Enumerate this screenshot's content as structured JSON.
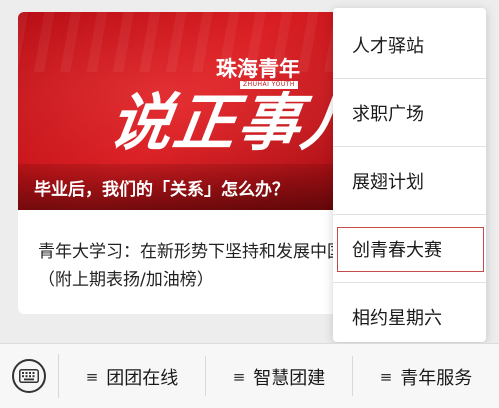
{
  "article": {
    "banner": {
      "logo_text": "珠海青年",
      "logo_subtext": "ZHUHAI YOUTH",
      "big_title": "说正事儿",
      "caption": "毕业后，我们的「关系」怎么办？"
    },
    "second_title": "青年大学习：在新形势下坚持和发展中国特色社会主义（附上期表扬/加油榜）"
  },
  "menu": {
    "items": [
      {
        "label": "人才驿站"
      },
      {
        "label": "求职广场"
      },
      {
        "label": "展翅计划"
      },
      {
        "label": "创青春大赛",
        "highlighted": true
      },
      {
        "label": "相约星期六"
      }
    ]
  },
  "bottom_bar": {
    "keyboard_icon": "keyboard-icon",
    "tabs": [
      {
        "label": "团团在线",
        "icon": "menu-lines-icon"
      },
      {
        "label": "智慧团建",
        "icon": "menu-lines-icon"
      },
      {
        "label": "青年服务",
        "icon": "menu-lines-icon"
      }
    ]
  },
  "colors": {
    "banner_red": "#c8151b",
    "highlight_border": "#c54a4a",
    "background": "#ededed"
  }
}
